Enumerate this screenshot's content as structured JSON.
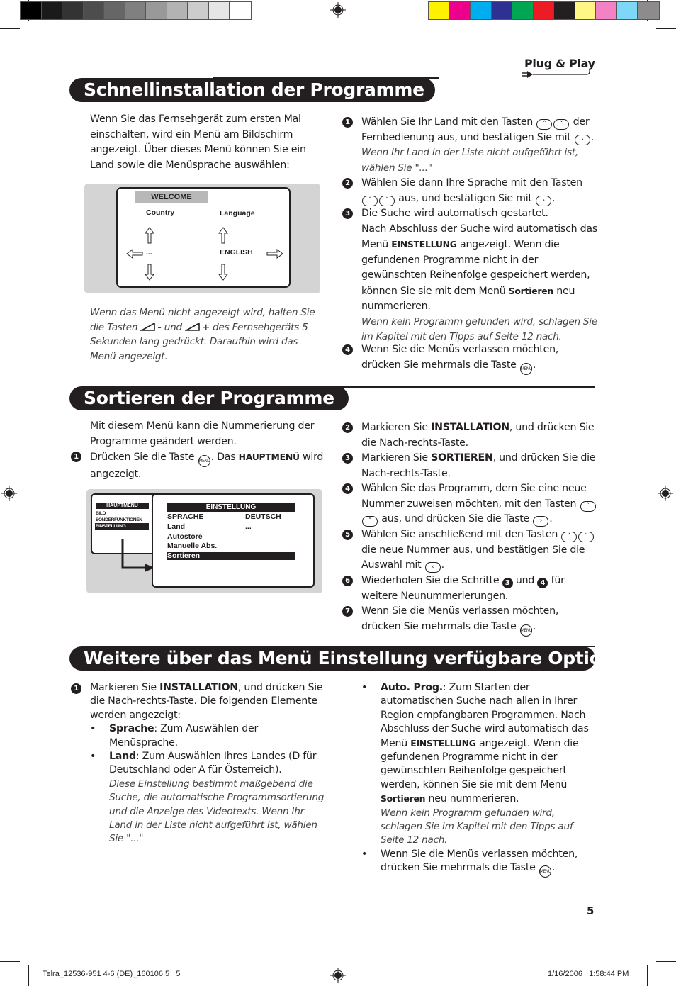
{
  "print_marks": {
    "grayscale_swatches": [
      "#000000",
      "#1a1a1a",
      "#333333",
      "#4d4d4d",
      "#666666",
      "#808080",
      "#999999",
      "#b3b3b3",
      "#cccccc",
      "#e6e6e6",
      "#ffffff"
    ],
    "color_swatches": [
      "#fff200",
      "#ec008c",
      "#00aeef",
      "#2e3192",
      "#00a651",
      "#ed1c24",
      "#231f20",
      "#fff685",
      "#f282c4",
      "#7dd8f8",
      "#8d8b8b"
    ]
  },
  "brand": {
    "plug_and_play": "Plug & Play"
  },
  "section1": {
    "title": "Schnellinstallation der Programme",
    "intro": "Wenn Sie das Fernsehgerät zum ersten Mal einschalten, wird ein Menü am Bildschirm angezeigt. Über dieses Menü können Sie ein Land sowie die Menüsprache auswählen:",
    "welcome_menu": {
      "title": "WELCOME",
      "country_label": "Country",
      "language_label": "Language",
      "country_value": "...",
      "language_value": "ENGLISH"
    },
    "note": {
      "part1": "Wenn das Menü nicht angezeigt wird, halten Sie die Tasten",
      "minus": "-",
      "und": "und",
      "plus": "+",
      "part2": "des Fernsehgeräts 5 Sekunden lang gedrückt. Daraufhin wird das Menü angezeigt."
    },
    "steps": [
      {
        "num": "1",
        "a": "Wählen Sie Ihr Land mit den Tasten",
        "b": "der Fernbedienung aus, und bestätigen Sie mit",
        "c": ".",
        "note": "Wenn Ihr Land in der Liste nicht aufgeführt ist, wählen Sie \"...\""
      },
      {
        "num": "2",
        "a": "Wählen Sie dann Ihre Sprache mit den Tasten",
        "b": "aus, und bestätigen Sie mit",
        "c": "."
      },
      {
        "num": "3",
        "a": "Die Suche wird automatisch gestartet.",
        "b": "Nach Abschluss der Suche wird automatisch das Menü",
        "bold1": "EINSTELLUNG",
        "c": "angezeigt. Wenn die gefundenen Programme nicht in der gewünschten Reihenfolge gespeichert werden, können Sie sie mit dem Menü",
        "bold2": "Sortieren",
        "d": "neu nummerieren.",
        "note": "Wenn kein Programm gefunden wird, schlagen Sie im Kapitel mit den Tipps auf Seite 12 nach."
      },
      {
        "num": "4",
        "a": "Wenn Sie die Menüs verlassen möchten, drücken Sie mehrmals die Taste",
        "c": "."
      }
    ]
  },
  "section2": {
    "title": "Sortieren der Programme",
    "intro": "Mit diesem Menü kann die Nummerierung der Programme geändert werden.",
    "steps": [
      {
        "num": "1",
        "a": "Drücken Sie die Taste",
        "b": ". Das",
        "bold": "HAUPTMENÜ",
        "c": "wird angezeigt."
      },
      {
        "num": "2",
        "a": "Markieren Sie",
        "bold": "INSTALLATION",
        "b": ", und drücken Sie die Nach-rechts-Taste."
      },
      {
        "num": "3",
        "a": "Markieren Sie",
        "bold": "SORTIEREN",
        "b": ", und drücken Sie die Nach-rechts-Taste."
      },
      {
        "num": "4",
        "a": "Wählen Sie das Programm, dem Sie eine neue Nummer zuweisen möchten, mit den Tasten",
        "b": "aus, und drücken Sie die Taste",
        "c": "."
      },
      {
        "num": "5",
        "a": "Wählen Sie anschließend mit den Tasten",
        "b": "die neue Nummer aus, und bestätigen Sie die Auswahl mit",
        "c": "."
      },
      {
        "num": "6",
        "a": "Wiederholen Sie die Schritte",
        "ref1": "3",
        "und": "und",
        "ref2": "4",
        "b": "für weitere Neunummerierungen."
      },
      {
        "num": "7",
        "a": "Wenn Sie die Menüs verlassen möchten, drücken Sie mehrmals die Taste",
        "c": "."
      }
    ],
    "main_menu": {
      "title": "HAUPTMENÜ",
      "items": [
        "BILD",
        "SONDERFUNKTIONEN",
        "EINSTELLUNG"
      ],
      "selected_index": 2
    },
    "settings_menu": {
      "title": "EINSTELLUNG",
      "rows": [
        {
          "label": "SPRACHE",
          "value": "DEUTSCH"
        },
        {
          "label": "Land",
          "value": "..."
        },
        {
          "label": "Autostore",
          "value": ""
        },
        {
          "label": "Manuelle Abs.",
          "value": ""
        },
        {
          "label": "Sortieren",
          "value": ""
        }
      ],
      "selected_index": 4
    }
  },
  "section3": {
    "title": "Weitere über das Menü Einstellung verfügbare Optionen",
    "step1": {
      "num": "1",
      "a": "Markieren Sie",
      "bold": "INSTALLATION",
      "b": ", und drücken Sie die Nach-rechts-Taste. Die folgenden Elemente werden angezeigt:"
    },
    "bullets": [
      {
        "bold": "Sprache",
        "text": ": Zum Auswählen der Menüsprache."
      },
      {
        "bold": "Land",
        "text": ": Zum Auswählen Ihres Landes (D für Deutschland oder A für Österreich).",
        "note": "Diese Einstellung bestimmt maßgebend die Suche, die automatische Programmsortierung und die Anzeige des Videotexts. Wenn Ihr Land in der Liste nicht aufgeführt ist, wählen Sie \"...\""
      },
      {
        "bold": "Auto. Prog.",
        "text": ": Zum Starten der automatischen Suche nach allen in Ihrer Region empfangbaren Programmen. Nach Abschluss der Suche wird automatisch das Menü",
        "bold2": "EINSTELLUNG",
        "text2": "angezeigt. Wenn die gefundenen Programme nicht in der gewünschten Reihenfolge gespeichert werden, können Sie sie mit dem Menü",
        "bold3": "Sortieren",
        "text3": "neu nummerieren.",
        "note": "Wenn kein Programm gefunden wird, schlagen Sie im Kapitel mit den Tipps auf Seite 12 nach."
      },
      {
        "text": "Wenn Sie die Menüs verlassen möchten, drücken Sie mehrmals die Taste",
        "end": "."
      }
    ],
    "bullet_char": "•"
  },
  "keys": {
    "up": "˄",
    "down": "˅",
    "right": "›",
    "left": "‹",
    "menu": "MENU"
  },
  "page_number": "5",
  "footer": {
    "file": "Telra_12536-951 4-6 (DE)_160106.5   5",
    "timestamp": "1/16/2006   1:58:44 PM"
  }
}
